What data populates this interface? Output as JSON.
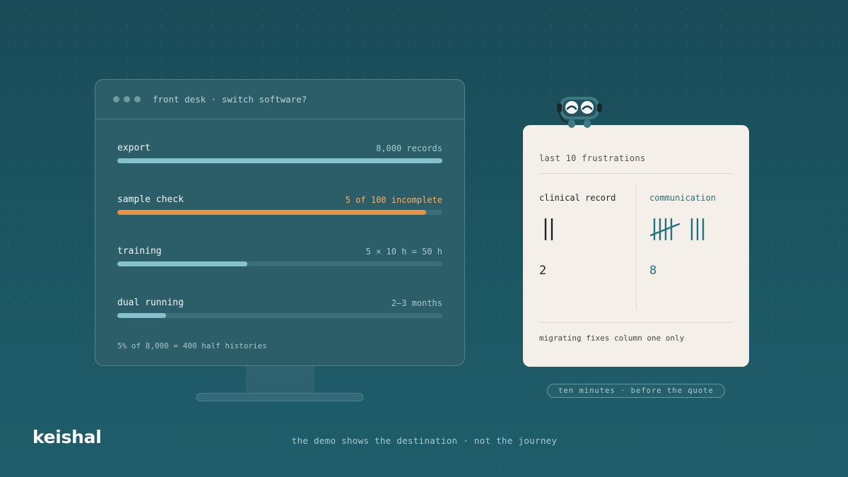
{
  "window": {
    "title": "front desk · switch software?"
  },
  "checklist": [
    {
      "label": "export",
      "value": "8,000 records",
      "progress": 1.0,
      "status": "normal"
    },
    {
      "label": "sample check",
      "value": "5 of 100 incomplete",
      "progress": 0.95,
      "status": "warning"
    },
    {
      "label": "training",
      "value": "5 × 10 h = 50 h",
      "progress": 0.4,
      "status": "normal"
    },
    {
      "label": "dual running",
      "value": "2–3 months",
      "progress": 0.15,
      "status": "normal"
    }
  ],
  "footnote": "5% of 8,000 = 400 half histories",
  "card": {
    "title": "last 10 frustrations",
    "columns": [
      {
        "heading": "clinical record",
        "count": "2",
        "tally": 2,
        "color": "#1d2327"
      },
      {
        "heading": "communication",
        "count": "8",
        "tally": 8,
        "color": "#24727e"
      }
    ],
    "footer": "migrating fixes column one only"
  },
  "pill": "ten minutes · before the quote",
  "brand": "keishal",
  "tagline": "the demo shows the destination · not the journey",
  "colors": {
    "background": "#1c5663",
    "accent": "#86c1ce",
    "warning": "#ea9243",
    "card": "#f4efe9",
    "teal_text": "#24727e"
  },
  "icons": {
    "mascot": "headset-robot-icon",
    "window_controls": "window-dots-icon"
  }
}
